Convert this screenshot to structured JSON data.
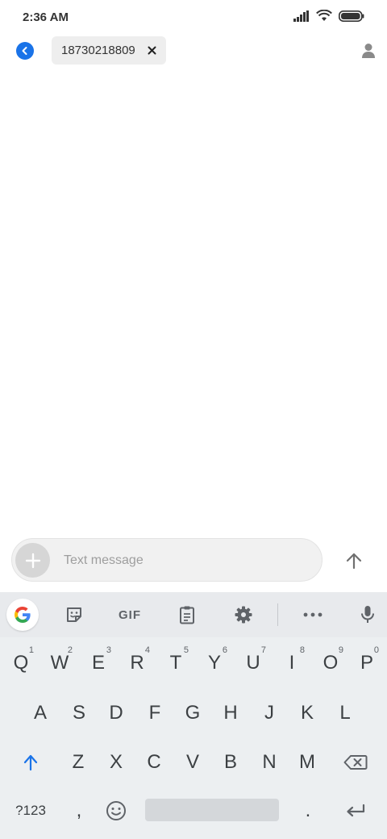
{
  "status_bar": {
    "time": "2:36 AM"
  },
  "header": {
    "recipient": "18730218809"
  },
  "compose": {
    "placeholder": "Text message"
  },
  "keyboard": {
    "toolbar": {
      "gif_label": "GIF"
    },
    "row1": [
      {
        "label": "Q",
        "hint": "1"
      },
      {
        "label": "W",
        "hint": "2"
      },
      {
        "label": "E",
        "hint": "3"
      },
      {
        "label": "R",
        "hint": "4"
      },
      {
        "label": "T",
        "hint": "5"
      },
      {
        "label": "Y",
        "hint": "6"
      },
      {
        "label": "U",
        "hint": "7"
      },
      {
        "label": "I",
        "hint": "8"
      },
      {
        "label": "O",
        "hint": "9"
      },
      {
        "label": "P",
        "hint": "0"
      }
    ],
    "row2": [
      "A",
      "S",
      "D",
      "F",
      "G",
      "H",
      "J",
      "K",
      "L"
    ],
    "row3": [
      "Z",
      "X",
      "C",
      "V",
      "B",
      "N",
      "M"
    ],
    "bottom": {
      "symbols": "?123",
      "comma": ",",
      "period": "."
    }
  },
  "colors": {
    "accent": "#1a73e8",
    "keyboard_bg": "#eceff1",
    "shift_blue": "#1a73e8"
  },
  "icons": [
    "signal-icon",
    "wifi-icon",
    "battery-icon",
    "back-arrow-icon",
    "close-icon",
    "person-icon",
    "plus-icon",
    "send-arrow-icon",
    "google-icon",
    "sticker-icon",
    "clipboard-icon",
    "gear-icon",
    "more-icon",
    "mic-icon",
    "shift-icon",
    "backspace-icon",
    "emoji-icon",
    "enter-icon"
  ]
}
